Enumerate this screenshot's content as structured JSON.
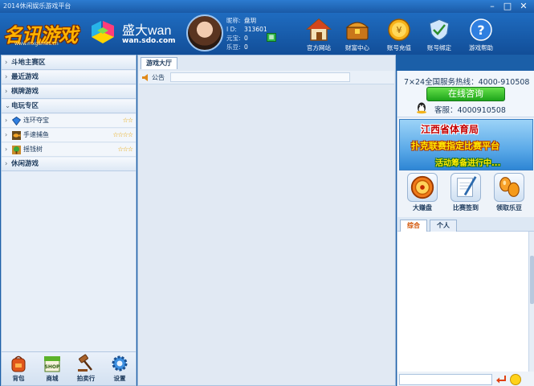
{
  "window": {
    "title": "2014休闲娱乐游戏平台",
    "controls": [
      "–",
      "□",
      "✕"
    ]
  },
  "header": {
    "logo_main": "名讯游戏",
    "logo_url": "www.mxgames.cn",
    "partner_brand": "盛大wan",
    "partner_domain": "wan.sdo.com",
    "user": {
      "nickname_label": "昵称:",
      "nickname": "盘玥",
      "id_label": "I D:",
      "id": "313601",
      "yuanbao_label": "元宝:",
      "yuanbao": "0",
      "ledou_label": "乐豆:",
      "ledou": "0",
      "qr_icon": "qr-icon"
    },
    "nav": [
      {
        "label": "官方网站",
        "icon": "house-icon"
      },
      {
        "label": "财富中心",
        "icon": "treasure-chest-icon"
      },
      {
        "label": "账号充值",
        "icon": "coin-icon"
      },
      {
        "label": "账号绑定",
        "icon": "shield-icon"
      },
      {
        "label": "游戏帮助",
        "icon": "help-icon"
      }
    ]
  },
  "left": {
    "categories": [
      {
        "label": "斗地主赛区",
        "arrow": "›"
      },
      {
        "label": "最近游戏",
        "arrow": "›"
      },
      {
        "label": "棋牌游戏",
        "arrow": "›"
      },
      {
        "label": "电玩专区",
        "arrow": "⌄"
      }
    ],
    "games": [
      {
        "name": "连环夺宝",
        "stars": "☆☆",
        "icon": "gem-icon"
      },
      {
        "name": "手速捕鱼",
        "stars": "☆☆☆☆",
        "icon": "fish-icon"
      },
      {
        "name": "摇钱树",
        "stars": "☆☆☆",
        "icon": "tree-icon"
      }
    ],
    "last_category": {
      "label": "休闲游戏",
      "arrow": "›"
    },
    "bottom": [
      {
        "label": "背包",
        "icon": "backpack-icon"
      },
      {
        "label": "商城",
        "icon": "shop-icon"
      },
      {
        "label": "拍卖行",
        "icon": "gavel-icon"
      },
      {
        "label": "设置",
        "icon": "gear-icon"
      }
    ]
  },
  "center": {
    "tab": "游戏大厅",
    "notice_label": "公告"
  },
  "right": {
    "hotline": "7×24全国服务热线：4000-910508",
    "consult_button": "在线咨询",
    "kefu": "客服：4000910508",
    "banner": {
      "line1": "江西省体育局",
      "line2": "扑克联赛指定比赛平台",
      "line3": "活动筹备进行中..."
    },
    "actions": [
      {
        "label": "大赚盘",
        "icon": "wheel-icon"
      },
      {
        "label": "比赛签到",
        "icon": "pen-icon"
      },
      {
        "label": "领取乐豆",
        "icon": "beans-icon"
      }
    ],
    "chat_tabs": [
      "综合",
      "个人"
    ]
  }
}
